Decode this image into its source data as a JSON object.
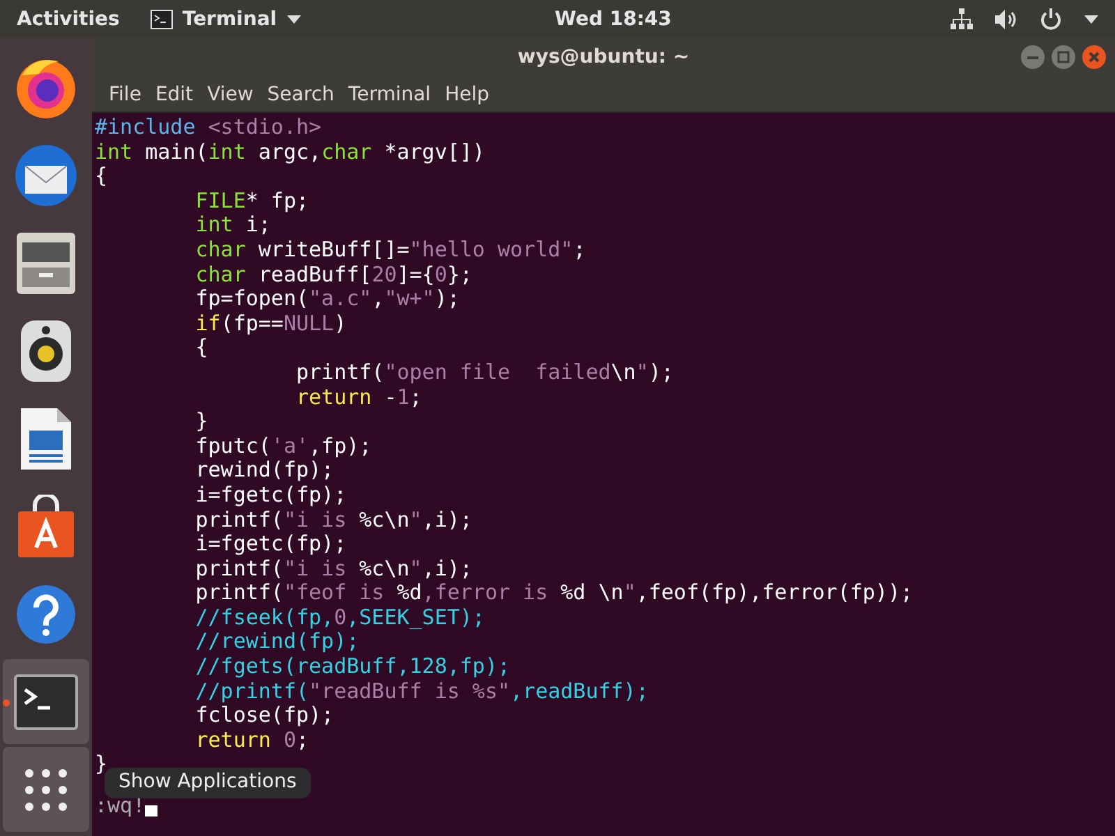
{
  "top_bar": {
    "activities": "Activities",
    "app_menu": "Terminal",
    "clock": "Wed 18:43"
  },
  "dock": {
    "items": [
      {
        "kind": "browser",
        "running": false,
        "highlighted": false
      },
      {
        "kind": "mail",
        "running": false,
        "highlighted": false
      },
      {
        "kind": "files",
        "running": false,
        "highlighted": false
      },
      {
        "kind": "music",
        "running": false,
        "highlighted": false
      },
      {
        "kind": "writer",
        "running": false,
        "highlighted": false
      },
      {
        "kind": "software",
        "running": false,
        "highlighted": false
      },
      {
        "kind": "help",
        "running": false,
        "highlighted": false
      },
      {
        "kind": "terminal",
        "running": true,
        "highlighted": true
      },
      {
        "kind": "apps",
        "running": false,
        "highlighted": true
      }
    ],
    "tooltip": "Show Applications"
  },
  "window": {
    "title": "wys@ubuntu: ~",
    "menu": [
      "File",
      "Edit",
      "View",
      "Search",
      "Terminal",
      "Help"
    ],
    "lines": [
      [
        {
          "kind": "preproc",
          "text": "#include"
        },
        {
          "kind": "string",
          "text": " <stdio.h>"
        }
      ],
      [
        {
          "kind": "type",
          "text": "int"
        },
        {
          "kind": "plain",
          "text": " main("
        },
        {
          "kind": "type",
          "text": "int"
        },
        {
          "kind": "plain",
          "text": " argc,"
        },
        {
          "kind": "type",
          "text": "char"
        },
        {
          "kind": "plain",
          "text": " *argv[])"
        }
      ],
      [
        {
          "kind": "plain",
          "text": "{"
        }
      ],
      [
        {
          "kind": "type",
          "text": "        FILE"
        },
        {
          "kind": "plain",
          "text": "* fp;"
        }
      ],
      [
        {
          "kind": "type",
          "text": "        int"
        },
        {
          "kind": "plain",
          "text": " i;"
        }
      ],
      [
        {
          "kind": "type",
          "text": "        char"
        },
        {
          "kind": "plain",
          "text": " writeBuff[]="
        },
        {
          "kind": "string",
          "text": "\"hello world\""
        },
        {
          "kind": "plain",
          "text": ";"
        }
      ],
      [
        {
          "kind": "type",
          "text": "        char"
        },
        {
          "kind": "plain",
          "text": " readBuff["
        },
        {
          "kind": "string",
          "text": "20"
        },
        {
          "kind": "plain",
          "text": "]={"
        },
        {
          "kind": "string",
          "text": "0"
        },
        {
          "kind": "plain",
          "text": "};"
        }
      ],
      [
        {
          "kind": "plain",
          "text": "        fp=fopen("
        },
        {
          "kind": "string",
          "text": "\"a.c\""
        },
        {
          "kind": "plain",
          "text": ","
        },
        {
          "kind": "string",
          "text": "\"w+\""
        },
        {
          "kind": "plain",
          "text": ");"
        }
      ],
      [
        {
          "kind": "keyword",
          "text": "        if"
        },
        {
          "kind": "plain",
          "text": "(fp=="
        },
        {
          "kind": "string",
          "text": "NULL"
        },
        {
          "kind": "plain",
          "text": ")"
        }
      ],
      [
        {
          "kind": "plain",
          "text": "        {"
        }
      ],
      [
        {
          "kind": "plain",
          "text": "                printf("
        },
        {
          "kind": "string",
          "text": "\"open file  failed"
        },
        {
          "kind": "plain",
          "text": "\\n"
        },
        {
          "kind": "string",
          "text": "\""
        },
        {
          "kind": "plain",
          "text": ");"
        }
      ],
      [
        {
          "kind": "keyword",
          "text": "                return"
        },
        {
          "kind": "plain",
          "text": " -"
        },
        {
          "kind": "string",
          "text": "1"
        },
        {
          "kind": "plain",
          "text": ";"
        }
      ],
      [
        {
          "kind": "plain",
          "text": "        }"
        }
      ],
      [
        {
          "kind": "plain",
          "text": "        fputc("
        },
        {
          "kind": "string",
          "text": "'a'"
        },
        {
          "kind": "plain",
          "text": ",fp);"
        }
      ],
      [
        {
          "kind": "plain",
          "text": "        rewind(fp);"
        }
      ],
      [
        {
          "kind": "plain",
          "text": "        i=fgetc(fp);"
        }
      ],
      [
        {
          "kind": "plain",
          "text": "        printf("
        },
        {
          "kind": "string",
          "text": "\"i is "
        },
        {
          "kind": "plain",
          "text": "%c\\n"
        },
        {
          "kind": "string",
          "text": "\""
        },
        {
          "kind": "plain",
          "text": ",i);"
        }
      ],
      [
        {
          "kind": "plain",
          "text": "        i=fgetc(fp);"
        }
      ],
      [
        {
          "kind": "plain",
          "text": "        printf("
        },
        {
          "kind": "string",
          "text": "\"i is "
        },
        {
          "kind": "plain",
          "text": "%c\\n"
        },
        {
          "kind": "string",
          "text": "\""
        },
        {
          "kind": "plain",
          "text": ",i);"
        }
      ],
      [
        {
          "kind": "plain",
          "text": "        printf("
        },
        {
          "kind": "string",
          "text": "\"feof is "
        },
        {
          "kind": "plain",
          "text": "%d"
        },
        {
          "kind": "string",
          "text": ",ferror is "
        },
        {
          "kind": "plain",
          "text": "%d \\n"
        },
        {
          "kind": "string",
          "text": "\""
        },
        {
          "kind": "plain",
          "text": ",feof(fp),ferror(fp));"
        }
      ],
      [
        {
          "kind": "comment",
          "text": "        //fseek(fp,"
        },
        {
          "kind": "string",
          "text": "0"
        },
        {
          "kind": "comment",
          "text": ",SEEK_SET);"
        }
      ],
      [
        {
          "kind": "comment",
          "text": "        //rewind(fp);"
        }
      ],
      [
        {
          "kind": "comment",
          "text": "        //fgets(readBuff,128,fp);"
        }
      ],
      [
        {
          "kind": "comment",
          "text": "        //printf("
        },
        {
          "kind": "string",
          "text": "\"readBuff is %s\""
        },
        {
          "kind": "comment",
          "text": ",readBuff);"
        }
      ],
      [
        {
          "kind": "plain",
          "text": "        fclose(fp);"
        }
      ],
      [
        {
          "kind": "keyword",
          "text": "        return"
        },
        {
          "kind": "string",
          "text": " 0"
        },
        {
          "kind": "plain",
          "text": ";"
        }
      ],
      [
        {
          "kind": "plain",
          "text": "}"
        }
      ]
    ],
    "command": ":wq!"
  }
}
